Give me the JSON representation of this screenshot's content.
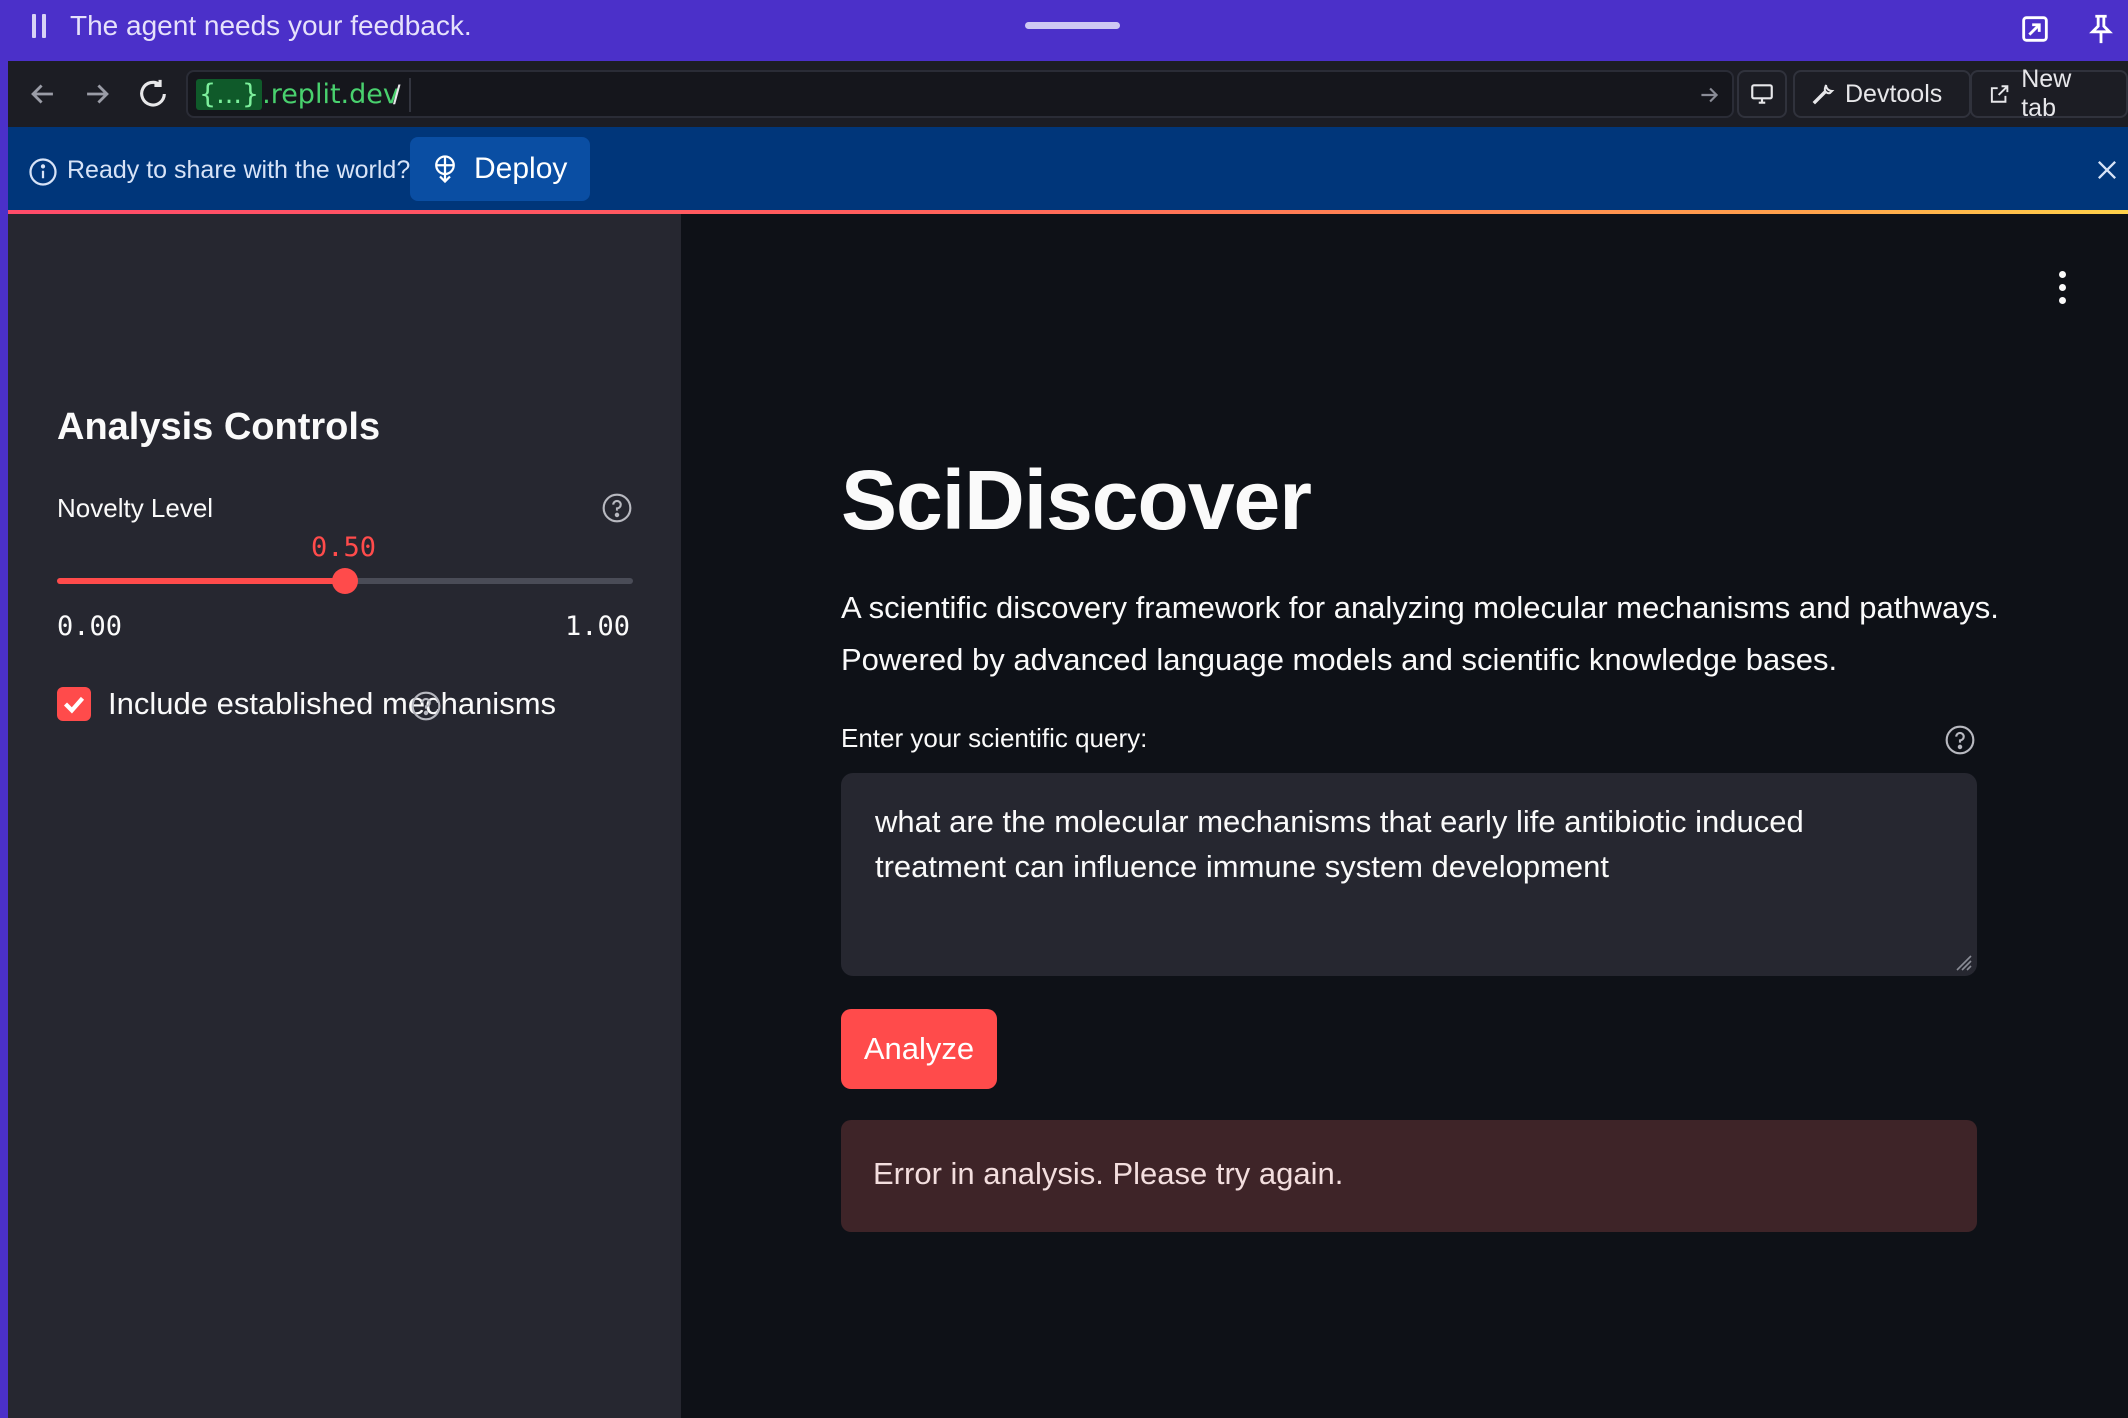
{
  "agent_banner": {
    "message": "The agent needs your feedback."
  },
  "browser": {
    "url_domain_brace": "{...}",
    "url_domain_suffix": ".replit.dev",
    "url_path": "/",
    "devtools_label": "Devtools",
    "new_tab_label": "New tab"
  },
  "deploy_banner": {
    "text": "Ready to share with the world?",
    "button_label": "Deploy"
  },
  "sidebar": {
    "title": "Analysis Controls",
    "slider": {
      "label": "Novelty Level",
      "value": "0.50",
      "value_fraction": 0.5,
      "min": "0.00",
      "max": "1.00"
    },
    "checkbox": {
      "label": "Include established mechanisms",
      "checked": true
    }
  },
  "main": {
    "title": "SciDiscover",
    "description": "A scientific discovery framework for analyzing molecular mechanisms and pathways. Powered by advanced language models and scientific knowledge bases.",
    "query_label": "Enter your scientific query:",
    "query_value": "what are the molecular mechanisms that early life antibiotic induced treatment can influence immune system development",
    "analyze_label": "Analyze",
    "error_message": "Error in analysis. Please try again."
  },
  "colors": {
    "agent_bar": "#4b30c9",
    "deploy_bar": "#00367a",
    "accent": "#ff4b4b",
    "sidebar_bg": "#262730",
    "main_bg": "#0e1117",
    "error_bg": "#3e2428"
  }
}
